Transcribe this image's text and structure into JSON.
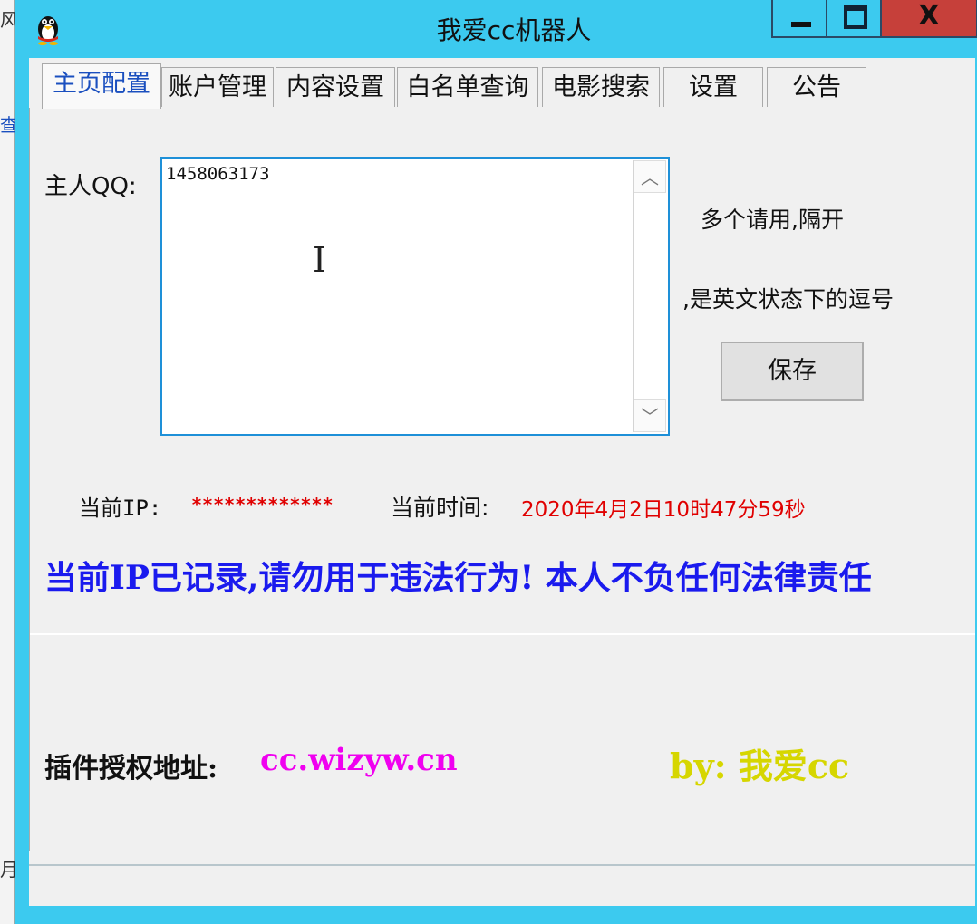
{
  "background_fragments": [
    "风",
    "查",
    "月"
  ],
  "window": {
    "title": "我爱cc机器人",
    "icon": "penguin-icon",
    "controls": {
      "minimize": "minimize-icon",
      "maximize": "maximize-icon",
      "close": "X"
    },
    "colors": {
      "frame": "#3ccaef",
      "close": "#c6403a"
    }
  },
  "tabs": [
    {
      "label": "主页配置",
      "active": true
    },
    {
      "label": "账户管理"
    },
    {
      "label": "内容设置"
    },
    {
      "label": "白名单查询"
    },
    {
      "label": "电影搜索"
    },
    {
      "label": "设置"
    },
    {
      "label": "公告"
    }
  ],
  "main": {
    "master_label": "主人QQ:",
    "master_value": "1458063173",
    "hint_multi": "多个请用,隔开",
    "hint_comma": ",是英文状态下的逗号",
    "save_label": "保存",
    "ip_label": "当前IP:",
    "ip_value": "*************",
    "time_label": "当前时间:",
    "time_value": "2020年4月2日10时47分59秒",
    "warning": "当前IP已记录,请勿用于违法行为! 本人不负任何法律责任",
    "auth_label": "插件授权地址:",
    "auth_url": "cc.wizyw.cn",
    "byline": "by: 我爱cc"
  },
  "colors": {
    "accent_red": "#e00000",
    "warning_blue": "#1a1aee",
    "url_magenta": "#f000f0",
    "byline_yellow": "#d6d600"
  }
}
